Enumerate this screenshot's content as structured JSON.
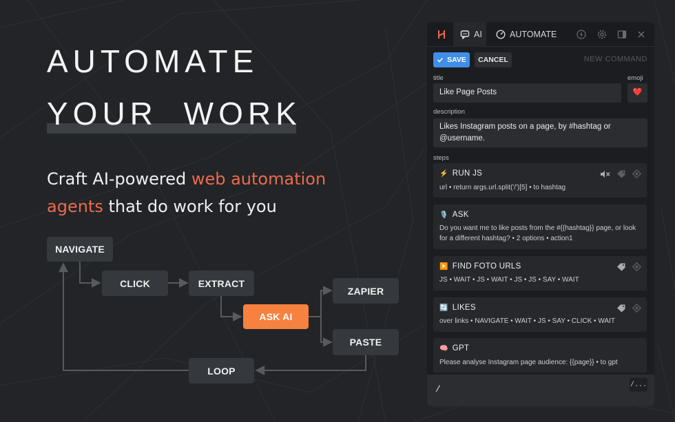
{
  "hero": {
    "line1": "AUTOMATE",
    "line2": "YOUR WORK",
    "sub_a": "Craft AI-powered ",
    "sub_accent1": "web automation",
    "sub_accent2": "agents",
    "sub_b": " that do work for you"
  },
  "flow": {
    "navigate": "NAVIGATE",
    "click": "CLICK",
    "extract": "EXTRACT",
    "ask_ai": "ASK AI",
    "zapier": "ZAPIER",
    "paste": "PASTE",
    "loop": "LOOP"
  },
  "panel": {
    "tabs": {
      "ai": "AI",
      "automate": "AUTOMATE"
    },
    "toolbar": {
      "save_label": "SAVE",
      "cancel_label": "CANCEL",
      "new_command": "NEW COMMAND"
    },
    "title_label": "title",
    "title_value": "Like Page Posts",
    "emoji_label": "emoji",
    "emoji_value": "❤️",
    "description_label": "description",
    "description_value": "Likes Instagram posts on a page, by #hashtag or @username.",
    "steps_label": "steps",
    "steps": [
      {
        "icon": "⚡",
        "name": "RUN JS",
        "detail": "url • return args.url.split('/')[5] • to hashtag"
      },
      {
        "icon": "🎙️",
        "name": "ASK",
        "detail": "Do you want me to like posts from the #{{hashtag}} page, or look for a different hashtag? • 2 options • action1"
      },
      {
        "icon": "▶️",
        "name": "FIND FOTO URLS",
        "detail": "JS • WAIT • JS • WAIT • JS • JS • SAY • WAIT"
      },
      {
        "icon": "🔄",
        "name": "LIKES",
        "detail": "over links • NAVIGATE • WAIT • JS • SAY • CLICK • WAIT"
      },
      {
        "icon": "🧠",
        "name": "GPT",
        "detail": "Please analyse Instagram page audience: {{page}} • to gpt"
      }
    ],
    "command": {
      "prompt": "/",
      "more": "/..."
    }
  },
  "colors": {
    "accent": "#ec6a4e",
    "orange_node": "#f7813e",
    "save_blue": "#3f8ee8",
    "background": "#222427"
  }
}
